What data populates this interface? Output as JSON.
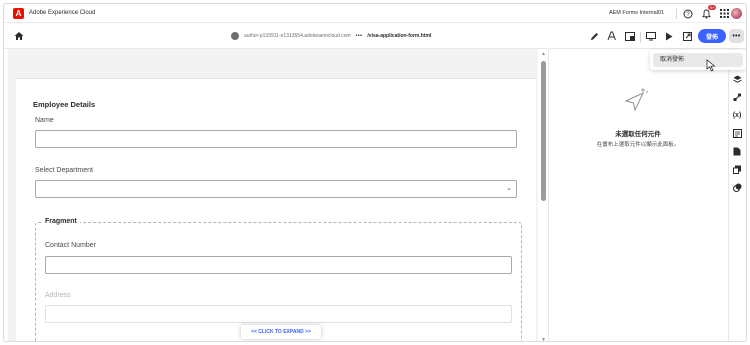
{
  "header": {
    "brand": "Adobe Experience Cloud",
    "logo_letter": "A",
    "org_name": "AEM Forms Internal01",
    "notification_count": "9+"
  },
  "toolbar": {
    "host": "author-p133911-e1313554.adobeaemcloud.com",
    "dots": "•••",
    "path": "/visa-application-form.html",
    "publish_label": "發佈",
    "more_label": "•••"
  },
  "menu": {
    "items": [
      {
        "label": "取消發佈"
      }
    ]
  },
  "form": {
    "section_title": "Employee Details",
    "name_label": "Name",
    "department_label": "Select Department",
    "fragment_title": "Fragment",
    "contact_label": "Contact Number",
    "address_label": "Address",
    "expand_label": "<< CLICK TO EXPAND >>"
  },
  "properties_panel": {
    "empty_title": "未選取任何元件",
    "empty_subtitle": "在畫布上選取元件以顯示此面板。"
  },
  "colors": {
    "accent": "#3b63fb",
    "adobe_red": "#eb1000"
  }
}
